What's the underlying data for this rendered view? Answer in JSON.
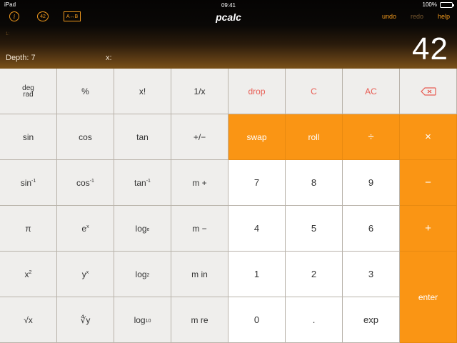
{
  "status": {
    "time": "09:41",
    "left": "iPad",
    "battery": "100%"
  },
  "toolbar": {
    "info_label": "i",
    "recall_label": "42",
    "swap_ab_label": "A↔B",
    "app_title": "pcalc",
    "undo_label": "undo",
    "redo_label": "redo",
    "help_label": "help"
  },
  "display": {
    "stack_hint": "1:",
    "depth_label": "Depth: 7",
    "x_label": "x:",
    "value": "42"
  },
  "keys": {
    "degrad_top": "deg",
    "degrad_bottom": "rad",
    "percent": "%",
    "factorial": "x!",
    "reciprocal": "1/x",
    "drop": "drop",
    "clear": "C",
    "all_clear": "AC",
    "sin": "sin",
    "cos": "cos",
    "tan": "tan",
    "negate": "+/−",
    "swap": "swap",
    "roll": "roll",
    "divide": "÷",
    "multiply": "×",
    "asin_base": "sin",
    "acos_base": "cos",
    "atan_base": "tan",
    "inv_exp": "-1",
    "memory_add": "m +",
    "seven": "7",
    "eight": "8",
    "nine": "9",
    "minus": "−",
    "pi": "π",
    "exp_base": "e",
    "exp_power": "x",
    "loge_base": "log",
    "loge_sub": "e",
    "memory_sub": "m −",
    "four": "4",
    "five": "5",
    "six": "6",
    "plus": "+",
    "square_base": "x",
    "square_power": "2",
    "ypow_base": "y",
    "ypow_power": "x",
    "log2_base": "log",
    "log2_sub": "2",
    "memory_in": "m in",
    "one": "1",
    "two": "2",
    "three": "3",
    "enter": "enter",
    "sqrt": "√x",
    "xroot": "∜y",
    "log10_base": "log",
    "log10_sub": "10",
    "memory_recall": "m re",
    "zero": "0",
    "decimal": ".",
    "exp": "exp"
  },
  "colors": {
    "accent": "#fa9514",
    "danger": "#e85d54",
    "key_bg": "#efeeec",
    "num_bg": "#ffffff"
  }
}
